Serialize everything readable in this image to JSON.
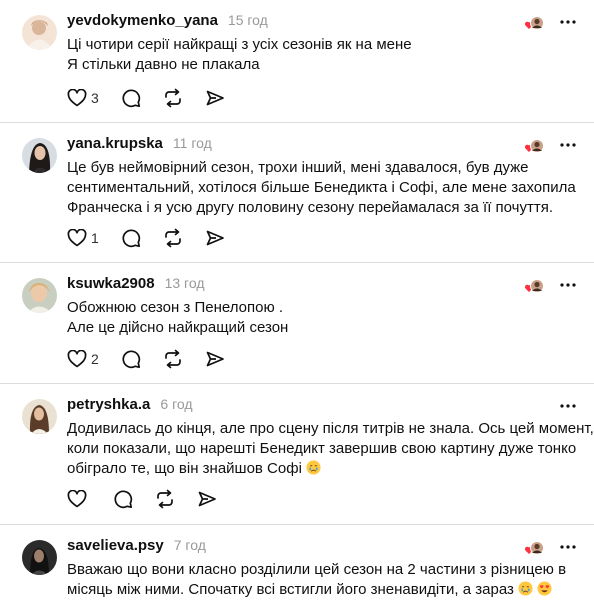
{
  "comments": [
    {
      "username": "yevdokymenko_yana",
      "time": "15 год",
      "lines": [
        "Ці чотири серії найкращі з усіх сезонів як на мене",
        "Я стільки давно не плакала"
      ],
      "like_count": "3",
      "liked_by_author": true
    },
    {
      "username": "yana.krupska",
      "time": "11 год",
      "lines": [
        "Це був неймовірний сезон, трохи інший, мені здавалося, був дуже",
        "сентиментальний, хотілося більше Бенедикта і Софі, але мене захопила",
        "Франческа і я усю другу половину сезону перейамалася за її почуття."
      ],
      "like_count": "1",
      "liked_by_author": true
    },
    {
      "username": "ksuwka2908",
      "time": "13 год",
      "lines": [
        "Обожнюю сезон з Пенелопою .",
        "Але це дійсно найкращий сезон"
      ],
      "like_count": "2",
      "liked_by_author": true
    },
    {
      "username": "petryshka.a",
      "time": "6 год",
      "lines": [
        "Додивилась до кінця, але про сцену після титрів не знала. Ось цей момент,",
        "коли показали, що нарешті Бенедикт завершив свою картину дуже тонко",
        "обіграло те, що він знайшов Софі"
      ],
      "like_count": "",
      "liked_by_author": false
    },
    {
      "username": "savelieva.psy",
      "time": "7 год",
      "lines": [
        "Вважаю що вони класно розділили цей сезон на 2 частини з різницею в",
        "місяць між ними. Спочатку всі встигли його зненавидіти, а зараз"
      ],
      "like_count": "",
      "liked_by_author": true
    }
  ],
  "icons": {
    "like": "heart-outline-icon",
    "reply": "speech-bubble-icon",
    "repost": "repost-icon",
    "share": "send-icon",
    "more": "more-dots-icon",
    "author_like": "author-liked-heart-icon"
  },
  "colors": {
    "liked_heart": "#ff3040",
    "time": "#999999",
    "divider": "#dcdcdc"
  }
}
